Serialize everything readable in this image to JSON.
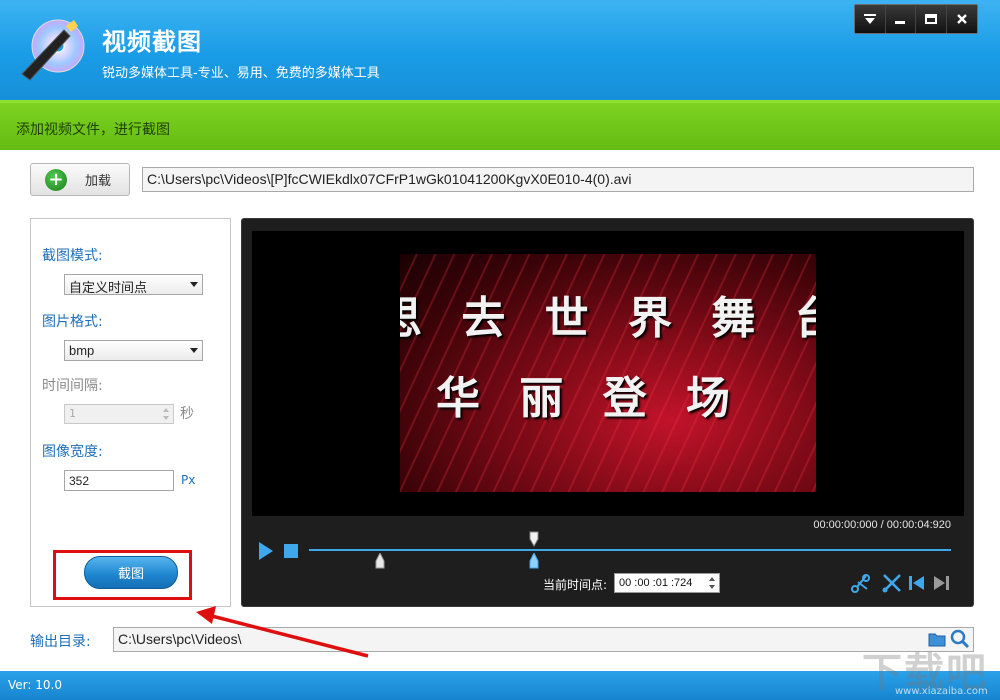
{
  "app": {
    "title": "视频截图",
    "subtitle": "锐动多媒体工具-专业、易用、免费的多媒体工具",
    "logo_icon": "disc-wand-icon"
  },
  "window_controls": [
    "menu-icon",
    "minimize-icon",
    "maximize-icon",
    "close-icon"
  ],
  "step": {
    "text": "添加视频文件，进行截图"
  },
  "load": {
    "button_label": "加载",
    "file_path": "C:\\Users\\pc\\Videos\\[P]fcCWIEkdlx07CFrP1wGk01041200KgvX0E010-4(0).avi"
  },
  "settings": {
    "mode_label": "截图模式:",
    "mode_value": "自定义时间点",
    "format_label": "图片格式:",
    "format_value": "bmp",
    "interval_label": "时间间隔:",
    "interval_value": "1",
    "interval_unit": "秒",
    "width_label": "图像宽度:",
    "width_value": "352",
    "width_unit": "Px",
    "capture_label": "截图"
  },
  "player": {
    "subtitle_line1": "思 去 世 界 舞 台",
    "subtitle_line2": "华 丽 登 场",
    "timecode": "00:00:00:000 / 00:00:04:920",
    "current_label": "当前时间点:",
    "current_value": "00 :00 :01 :724",
    "progress": {
      "start_marker_fraction": 0.11,
      "current_fraction": 0.35
    }
  },
  "output": {
    "label": "输出目录:",
    "path": "C:\\Users\\pc\\Videos\\"
  },
  "footer": {
    "version": "Ver: 10.0",
    "watermark": "下载吧",
    "watermark_sub": "www.xiazaiba.com"
  },
  "colors": {
    "header_blue": "#1a9ce6",
    "step_green": "#6cc418",
    "accent_blue": "#3fa7ec",
    "highlight_red": "#e00f0f"
  }
}
